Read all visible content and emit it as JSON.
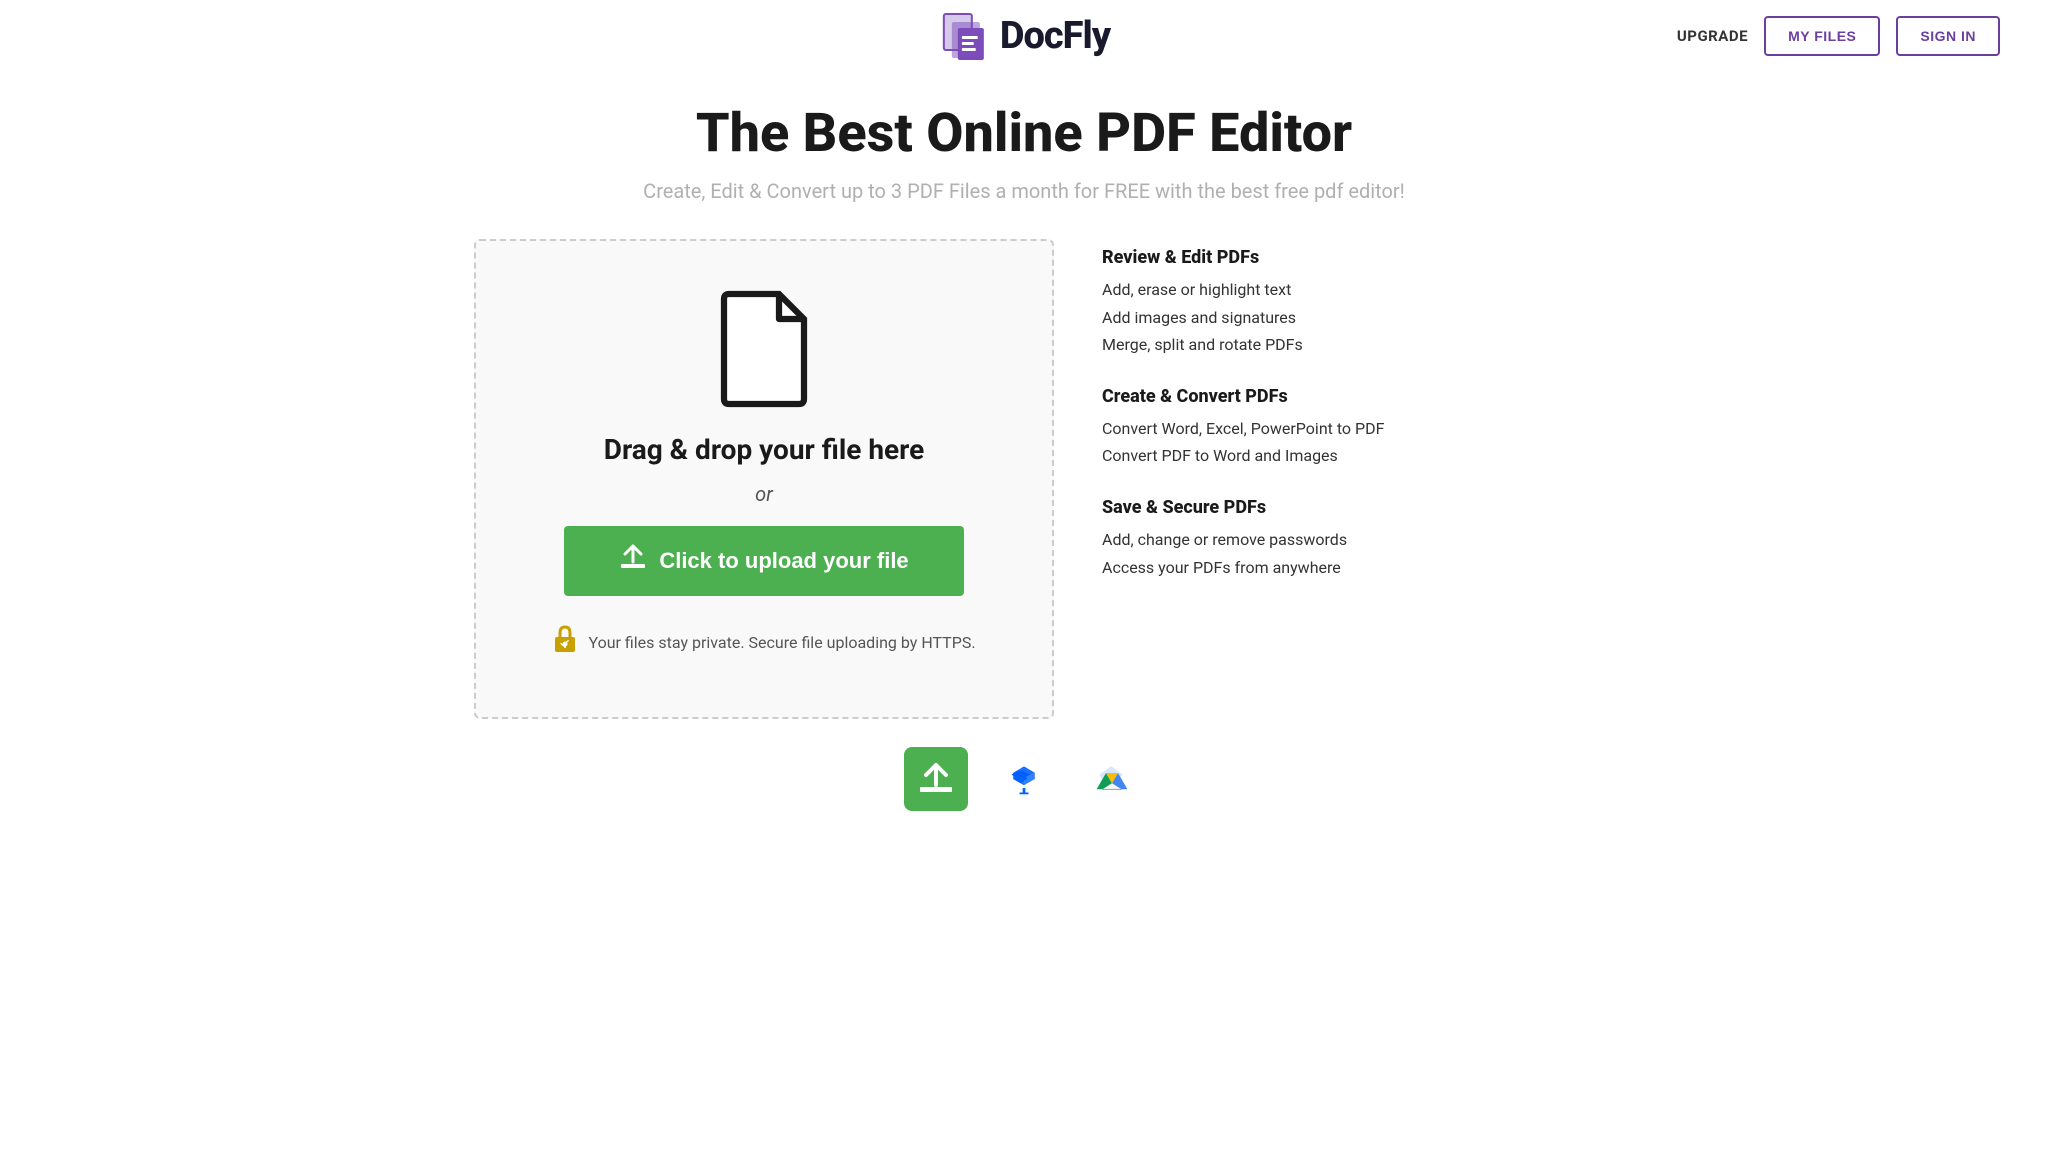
{
  "header": {
    "upgrade_label": "UPGRADE",
    "my_files_label": "MY FILES",
    "sign_in_label": "SIGN IN",
    "logo_text": "DocFly"
  },
  "hero": {
    "title": "The Best Online PDF Editor",
    "subtitle": "Create, Edit & Convert up to 3 PDF Files a month for FREE with the best free pdf editor!"
  },
  "upload": {
    "drag_drop_text": "Drag & drop your file here",
    "or_text": "or",
    "upload_btn_label": "Click to upload your file",
    "secure_text": "Your files stay private. Secure file uploading by HTTPS."
  },
  "features": {
    "sections": [
      {
        "title": "Review & Edit PDFs",
        "items": [
          "Add, erase or highlight text",
          "Add images and signatures",
          "Merge, split and rotate PDFs"
        ]
      },
      {
        "title": "Create & Convert PDFs",
        "items": [
          "Convert Word, Excel, PowerPoint to PDF",
          "Convert PDF to Word and Images"
        ]
      },
      {
        "title": "Save & Secure PDFs",
        "items": [
          "Add, change or remove passwords",
          "Access your PDFs from anywhere"
        ]
      }
    ]
  },
  "bottom_icons": [
    {
      "name": "upload-icon",
      "label": "Upload from computer",
      "active": true
    },
    {
      "name": "dropbox-icon",
      "label": "Upload from Dropbox",
      "active": false
    },
    {
      "name": "gdrive-icon",
      "label": "Upload from Google Drive",
      "active": false
    }
  ],
  "colors": {
    "purple": "#6b3fa0",
    "green": "#4caf50",
    "dark": "#1a1a1a",
    "gray": "#b0b0b0",
    "lock_gold": "#c8a000"
  }
}
